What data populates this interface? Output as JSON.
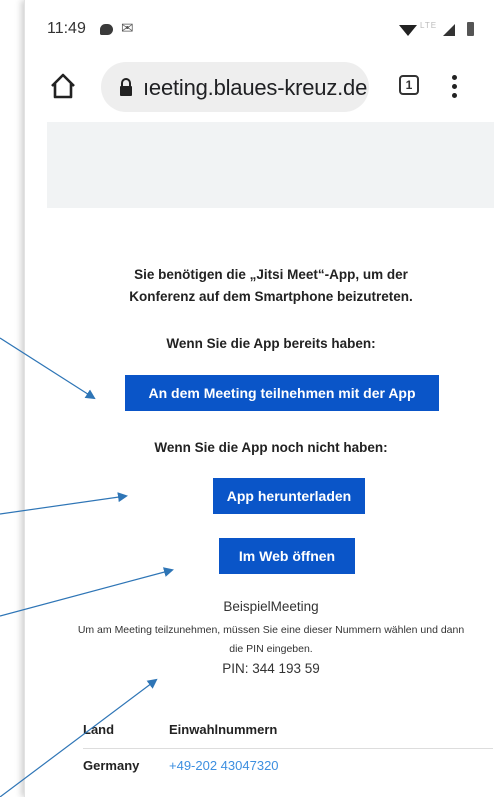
{
  "status_bar": {
    "time": "11:49",
    "icons": [
      "chat-bubble-icon",
      "gmail-icon",
      "wifi-icon",
      "lte-icon",
      "signal-icon",
      "battery-icon"
    ],
    "network_label": "LTE"
  },
  "browser": {
    "url": "ıeeting.blaues-kreuz.de",
    "tab_count": "1",
    "icons": [
      "home-icon",
      "lock-icon",
      "tabs-icon",
      "more-vert-icon"
    ]
  },
  "page": {
    "intro_text": "Sie benötigen die „Jitsi Meet“-App, um der Konferenz auf dem Smartphone beizutreten.",
    "have_app_label": "Wenn Sie die App bereits haben:",
    "join_button": "An dem Meeting teilnehmen mit der App",
    "no_app_label": "Wenn Sie die App noch nicht haben:",
    "download_button": "App herunterladen",
    "web_button": "Im Web öffnen",
    "meeting_name": "BeispielMeeting",
    "dial_info": "Um am Meeting teilzunehmen, müssen Sie eine dieser Nummern wählen und dann die PIN eingeben.",
    "pin": "PIN: 344 193 59",
    "table": {
      "headers": [
        "Land",
        "Einwahlnummern"
      ],
      "rows": [
        {
          "country": "Germany",
          "number": "+49-202 43047320"
        }
      ]
    }
  },
  "colors": {
    "button_bg": "#0a55c8",
    "link": "#3d8fe0",
    "banner": "#f1f3f4",
    "arrow": "#2e75b6"
  }
}
